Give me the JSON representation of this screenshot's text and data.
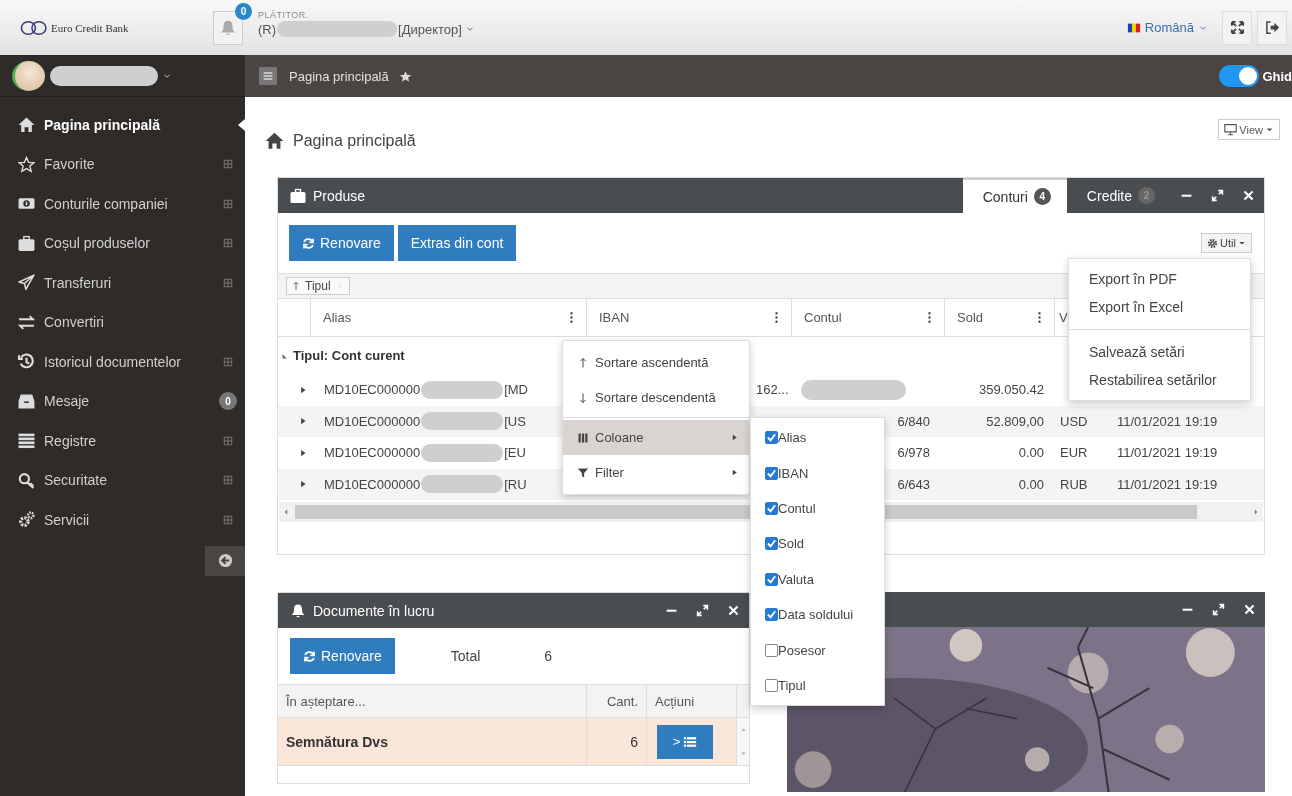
{
  "header": {
    "logo": "Euro Credit Bank",
    "notification_count": "0",
    "payer_label": "PLĂTITOR.",
    "payer_prefix": "(R)",
    "payer_role": "[Директор]",
    "language": "Română"
  },
  "top_bar": {
    "page_title": "Pagina principală",
    "guide": {
      "label": "Ghid",
      "on": true
    }
  },
  "sidebar": {
    "items": [
      {
        "label": "Pagina principală",
        "selected": true,
        "expandable": false
      },
      {
        "label": "Favorite",
        "selected": false,
        "expandable": true
      },
      {
        "label": "Conturile companiei",
        "selected": false,
        "expandable": true
      },
      {
        "label": "Coșul produselor",
        "selected": false,
        "expandable": true
      },
      {
        "label": "Transferuri",
        "selected": false,
        "expandable": true
      },
      {
        "label": "Convertiri",
        "selected": false,
        "expandable": false
      },
      {
        "label": "Istoricul documentelor",
        "selected": false,
        "expandable": true
      },
      {
        "label": "Mesaje",
        "selected": false,
        "badge": "0"
      },
      {
        "label": "Registre",
        "selected": false,
        "expandable": true
      },
      {
        "label": "Securitate",
        "selected": false,
        "expandable": true
      },
      {
        "label": "Servicii",
        "selected": false,
        "expandable": true
      }
    ]
  },
  "page": {
    "title": "Pagina principală",
    "view_button": "View"
  },
  "products_panel": {
    "title": "Produse",
    "tabs": [
      {
        "label": "Conturi",
        "count": "4",
        "selected": true
      },
      {
        "label": "Credite",
        "count": "2",
        "selected": false
      }
    ],
    "buttons": [
      "Renovare",
      "Extras din cont"
    ],
    "util_button": "Util",
    "group_chip": "Tipul",
    "columns": [
      "Alias",
      "IBAN",
      "Contul",
      "Sold",
      "V"
    ],
    "group_row": "Tipul: Cont curent",
    "rows": [
      {
        "alias": "MD10EC000000",
        "alias_tail": "[MD",
        "iban": "162...",
        "contul_hidden": true,
        "sold": "359.050.42",
        "expanded": false
      },
      {
        "alias": "MD10EC000000",
        "alias_tail": "[US",
        "contul": "6/840",
        "contul_hidden": false,
        "sold": "52.809,00",
        "valuta": "USD",
        "date": "11/01/2021 19:19",
        "expanded": false
      },
      {
        "alias": "MD10EC000000",
        "alias_tail": "[EU",
        "contul": "6/978",
        "contul_hidden": false,
        "sold": "0.00",
        "valuta": "EUR",
        "date": "11/01/2021 19:19",
        "expanded": false
      },
      {
        "alias": "MD10EC000000",
        "alias_tail": "[RU",
        "contul": "6/643",
        "contul_hidden": false,
        "sold": "0.00",
        "valuta": "RUB",
        "date": "11/01/2021 19:19",
        "expanded": false
      }
    ]
  },
  "column_menu": {
    "items": [
      {
        "kind": "sort-asc",
        "label": "Sortare ascendentă",
        "selected": false
      },
      {
        "kind": "sort-desc",
        "label": "Sortare descendentă",
        "selected": false
      },
      {
        "kind": "columns",
        "label": "Coloane",
        "selected": true
      },
      {
        "kind": "filter",
        "label": "Filter",
        "selected": false
      }
    ]
  },
  "columns_submenu": [
    {
      "label": "Alias",
      "checked": true
    },
    {
      "label": "IBAN",
      "checked": true
    },
    {
      "label": "Contul",
      "checked": true
    },
    {
      "label": "Sold",
      "checked": true
    },
    {
      "label": "Valuta",
      "checked": true
    },
    {
      "label": "Data soldului",
      "checked": true
    },
    {
      "label": "Posesor",
      "checked": false
    },
    {
      "label": "Tipul",
      "checked": false
    }
  ],
  "util_menu": {
    "groups": [
      [
        "Export în PDF",
        "Export în Excel"
      ],
      [
        "Salvează setări",
        "Restabilirea setărilor"
      ]
    ]
  },
  "documents_panel": {
    "title": "Documente în lucru",
    "button": "Renovare",
    "total_label": "Total",
    "total_value": "6",
    "columns": [
      "În așteptare...",
      "Cant.",
      "Acțiuni"
    ],
    "rows": [
      {
        "name": "Semnătura Dvs",
        "count": "6",
        "action": ">"
      }
    ]
  }
}
